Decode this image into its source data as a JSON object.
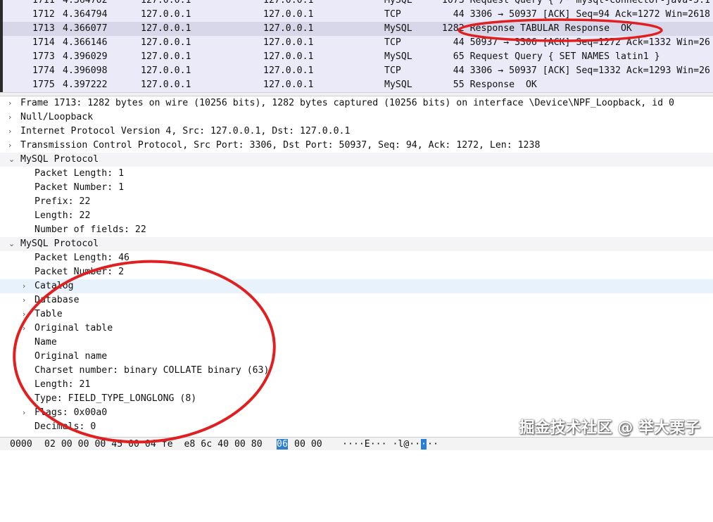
{
  "packets": [
    {
      "no": "1711",
      "time": "4.364702",
      "src": "127.0.0.1",
      "dst": "127.0.0.1",
      "proto": "MySQL",
      "info": "  1073 Request Query { /* mysql-connector-java-5.1"
    },
    {
      "no": "1712",
      "time": "4.364794",
      "src": "127.0.0.1",
      "dst": "127.0.0.1",
      "proto": "TCP",
      "info": "    44 3306 → 50937 [ACK] Seq=94 Ack=1272 Win=2618"
    },
    {
      "no": "1713",
      "time": "4.366077",
      "src": "127.0.0.1",
      "dst": "127.0.0.1",
      "proto": "MySQL",
      "info": "  1282 Response TABULAR Response  OK"
    },
    {
      "no": "1714",
      "time": "4.366146",
      "src": "127.0.0.1",
      "dst": "127.0.0.1",
      "proto": "TCP",
      "info": "    44 50937 → 3306 [ACK] Seq=1272 Ack=1332 Win=26"
    },
    {
      "no": "1773",
      "time": "4.396029",
      "src": "127.0.0.1",
      "dst": "127.0.0.1",
      "proto": "MySQL",
      "info": "    65 Request Query { SET NAMES latin1 }"
    },
    {
      "no": "1774",
      "time": "4.396098",
      "src": "127.0.0.1",
      "dst": "127.0.0.1",
      "proto": "TCP",
      "info": "    44 3306 → 50937 [ACK] Seq=1332 Ack=1293 Win=26"
    },
    {
      "no": "1775",
      "time": "4.397222",
      "src": "127.0.0.1",
      "dst": "127.0.0.1",
      "proto": "MySQL",
      "info": "    55 Response  OK"
    }
  ],
  "details": [
    {
      "indent": 0,
      "arrow": "›",
      "text": "Frame 1713: 1282 bytes on wire (10256 bits), 1282 bytes captured (10256 bits) on interface \\Device\\NPF_Loopback, id 0"
    },
    {
      "indent": 0,
      "arrow": "›",
      "text": "Null/Loopback"
    },
    {
      "indent": 0,
      "arrow": "›",
      "text": "Internet Protocol Version 4, Src: 127.0.0.1, Dst: 127.0.0.1"
    },
    {
      "indent": 0,
      "arrow": "›",
      "text": "Transmission Control Protocol, Src Port: 3306, Dst Port: 50937, Seq: 94, Ack: 1272, Len: 1238"
    },
    {
      "indent": 0,
      "arrow": "⌄",
      "text": "MySQL Protocol"
    },
    {
      "indent": 1,
      "arrow": "",
      "text": "Packet Length: 1"
    },
    {
      "indent": 1,
      "arrow": "",
      "text": "Packet Number: 1"
    },
    {
      "indent": 1,
      "arrow": "",
      "text": "Prefix: 22"
    },
    {
      "indent": 1,
      "arrow": "",
      "text": "Length: 22"
    },
    {
      "indent": 1,
      "arrow": "",
      "text": "Number of fields: 22"
    },
    {
      "indent": 0,
      "arrow": "⌄",
      "text": "MySQL Protocol"
    },
    {
      "indent": 1,
      "arrow": "",
      "text": "Packet Length: 46"
    },
    {
      "indent": 1,
      "arrow": "",
      "text": "Packet Number: 2"
    },
    {
      "indent": 1,
      "arrow": "›",
      "text": "Catalog"
    },
    {
      "indent": 1,
      "arrow": "›",
      "text": "Database"
    },
    {
      "indent": 1,
      "arrow": "›",
      "text": "Table"
    },
    {
      "indent": 1,
      "arrow": "›",
      "text": "Original table"
    },
    {
      "indent": 1,
      "arrow": "",
      "text": "Name"
    },
    {
      "indent": 1,
      "arrow": "",
      "text": "Original name"
    },
    {
      "indent": 1,
      "arrow": "",
      "text": "Charset number: binary COLLATE binary (63)"
    },
    {
      "indent": 1,
      "arrow": "",
      "text": "Length: 21"
    },
    {
      "indent": 1,
      "arrow": "",
      "text": "Type: FIELD_TYPE_LONGLONG (8)"
    },
    {
      "indent": 1,
      "arrow": "›",
      "text": "Flags: 0x00a0"
    },
    {
      "indent": 1,
      "arrow": "",
      "text": "Decimals: 0"
    }
  ],
  "hex": {
    "offset": "0000",
    "bytes_before": "02 00 00 00 45 00 04 fe  e8 6c 40 00 80",
    "bytes_highlight": "06",
    "bytes_after": "00 00",
    "ascii_before": "····E··· ·l@··",
    "ascii_highlight": "·",
    "ascii_after": "··"
  },
  "watermark": "掘金技术社区 @ 举大栗子",
  "colors": {
    "annotation": "#e02020",
    "selected_row": "#d8d7e9",
    "highlight": "#2b7ed8"
  }
}
